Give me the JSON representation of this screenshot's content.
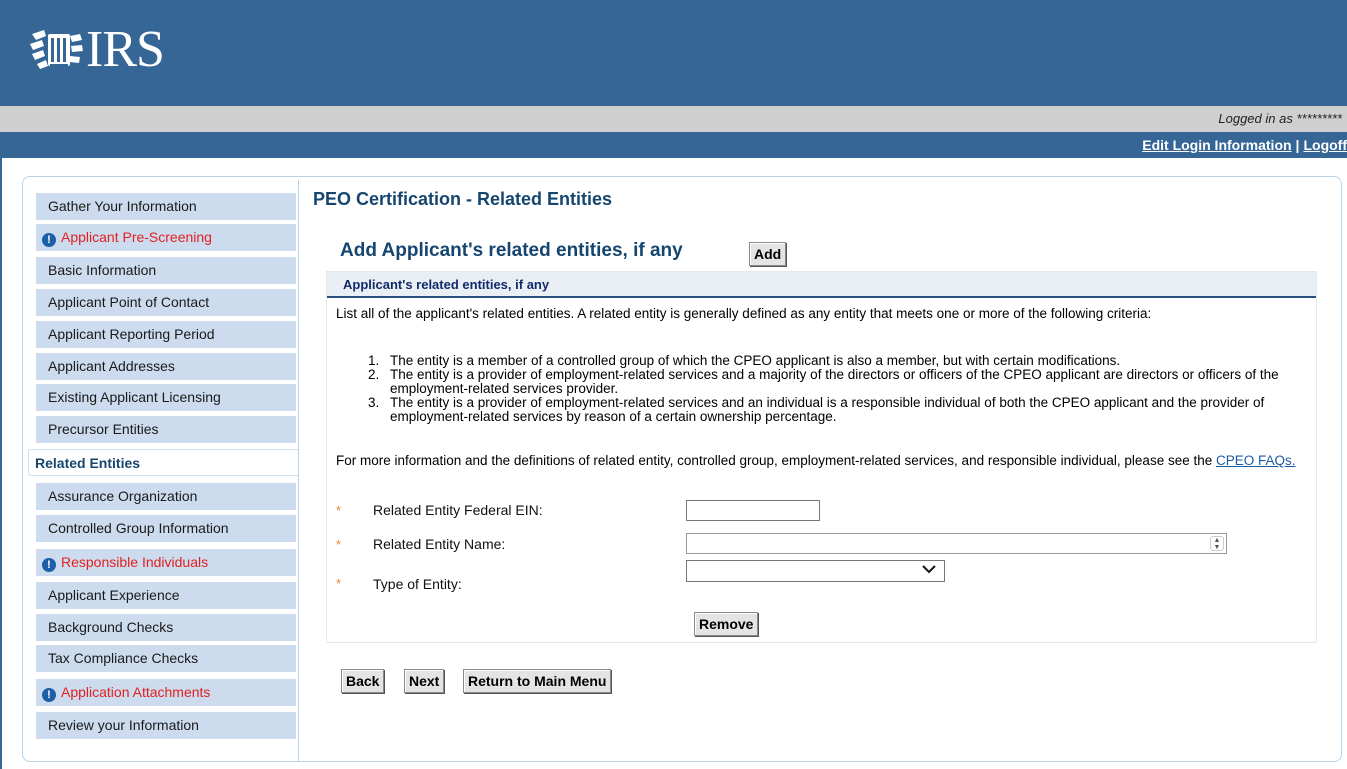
{
  "header": {
    "logo_text": "IRS",
    "logged_in": "Logged in as *********",
    "edit_login": "Edit Login Information",
    "separator": "|",
    "logoff": "Logoff"
  },
  "nav": {
    "items": [
      {
        "label": "Gather Your Information",
        "alert": false,
        "active": false
      },
      {
        "label": "Applicant Pre-Screening",
        "alert": true,
        "active": false
      },
      {
        "label": "Basic Information",
        "alert": false,
        "active": false
      },
      {
        "label": "Applicant Point of Contact",
        "alert": false,
        "active": false
      },
      {
        "label": "Applicant Reporting Period",
        "alert": false,
        "active": false
      },
      {
        "label": "Applicant Addresses",
        "alert": false,
        "active": false
      },
      {
        "label": "Existing Applicant Licensing",
        "alert": false,
        "active": false
      },
      {
        "label": "Precursor Entities",
        "alert": false,
        "active": false
      },
      {
        "label": "Related Entities",
        "alert": false,
        "active": true
      },
      {
        "label": "Assurance Organization",
        "alert": false,
        "active": false
      },
      {
        "label": "Controlled Group Information",
        "alert": false,
        "active": false
      },
      {
        "label": "Responsible Individuals",
        "alert": true,
        "active": false
      },
      {
        "label": "Applicant Experience",
        "alert": false,
        "active": false
      },
      {
        "label": "Background Checks",
        "alert": false,
        "active": false
      },
      {
        "label": "Tax Compliance Checks",
        "alert": false,
        "active": false
      },
      {
        "label": "Application Attachments",
        "alert": true,
        "active": false
      },
      {
        "label": "Review your Information",
        "alert": false,
        "active": false
      }
    ]
  },
  "main": {
    "page_title": "PEO Certification - Related Entities",
    "add_title": "Add Applicant's related entities, if any",
    "add_button": "Add",
    "section_title": "Applicant's related entities, if any",
    "intro": "List all of the applicant's related entities. A related entity is generally defined as any entity that meets one or more of the following criteria:",
    "criteria": [
      {
        "num": "1.",
        "text": "The entity is a member of a controlled group of which the CPEO applicant is also a member, but with certain modifications."
      },
      {
        "num": "2.",
        "text": "The entity is a provider of employment-related services and a majority of the directors or officers of the CPEO applicant are directors or officers of the employment-related services provider."
      },
      {
        "num": "3.",
        "text": "The entity is a provider of employment-related services and an individual is a responsible individual of both the CPEO applicant and the provider of employment-related services by reason of a certain ownership percentage."
      }
    ],
    "more_info_text": "For more information and the definitions of related entity, controlled group, employment-related services, and responsible individual, please see the",
    "more_info_link": "CPEO FAQs.",
    "required_mark": "*",
    "ein_label": "Related Entity Federal EIN:",
    "ein_value": "",
    "name_label": "Related Entity Name:",
    "name_value": "",
    "type_label": "Type of Entity:",
    "type_value": "",
    "remove_button": "Remove",
    "back_button": "Back",
    "next_button": "Next",
    "main_menu_button": "Return to Main Menu"
  },
  "colors": {
    "header_blue": "#356696",
    "nav_item_bg": "#ccdcee",
    "title_blue": "#16466f",
    "alert_red": "#e32020",
    "info_icon_blue": "#1d5fa8",
    "required_orange": "#e58a2a"
  },
  "icons": {
    "logo": "irs-eagle-logo",
    "alert": "info-circle-icon",
    "select": "chevron-down-icon",
    "spinner": "spinner-icon"
  }
}
